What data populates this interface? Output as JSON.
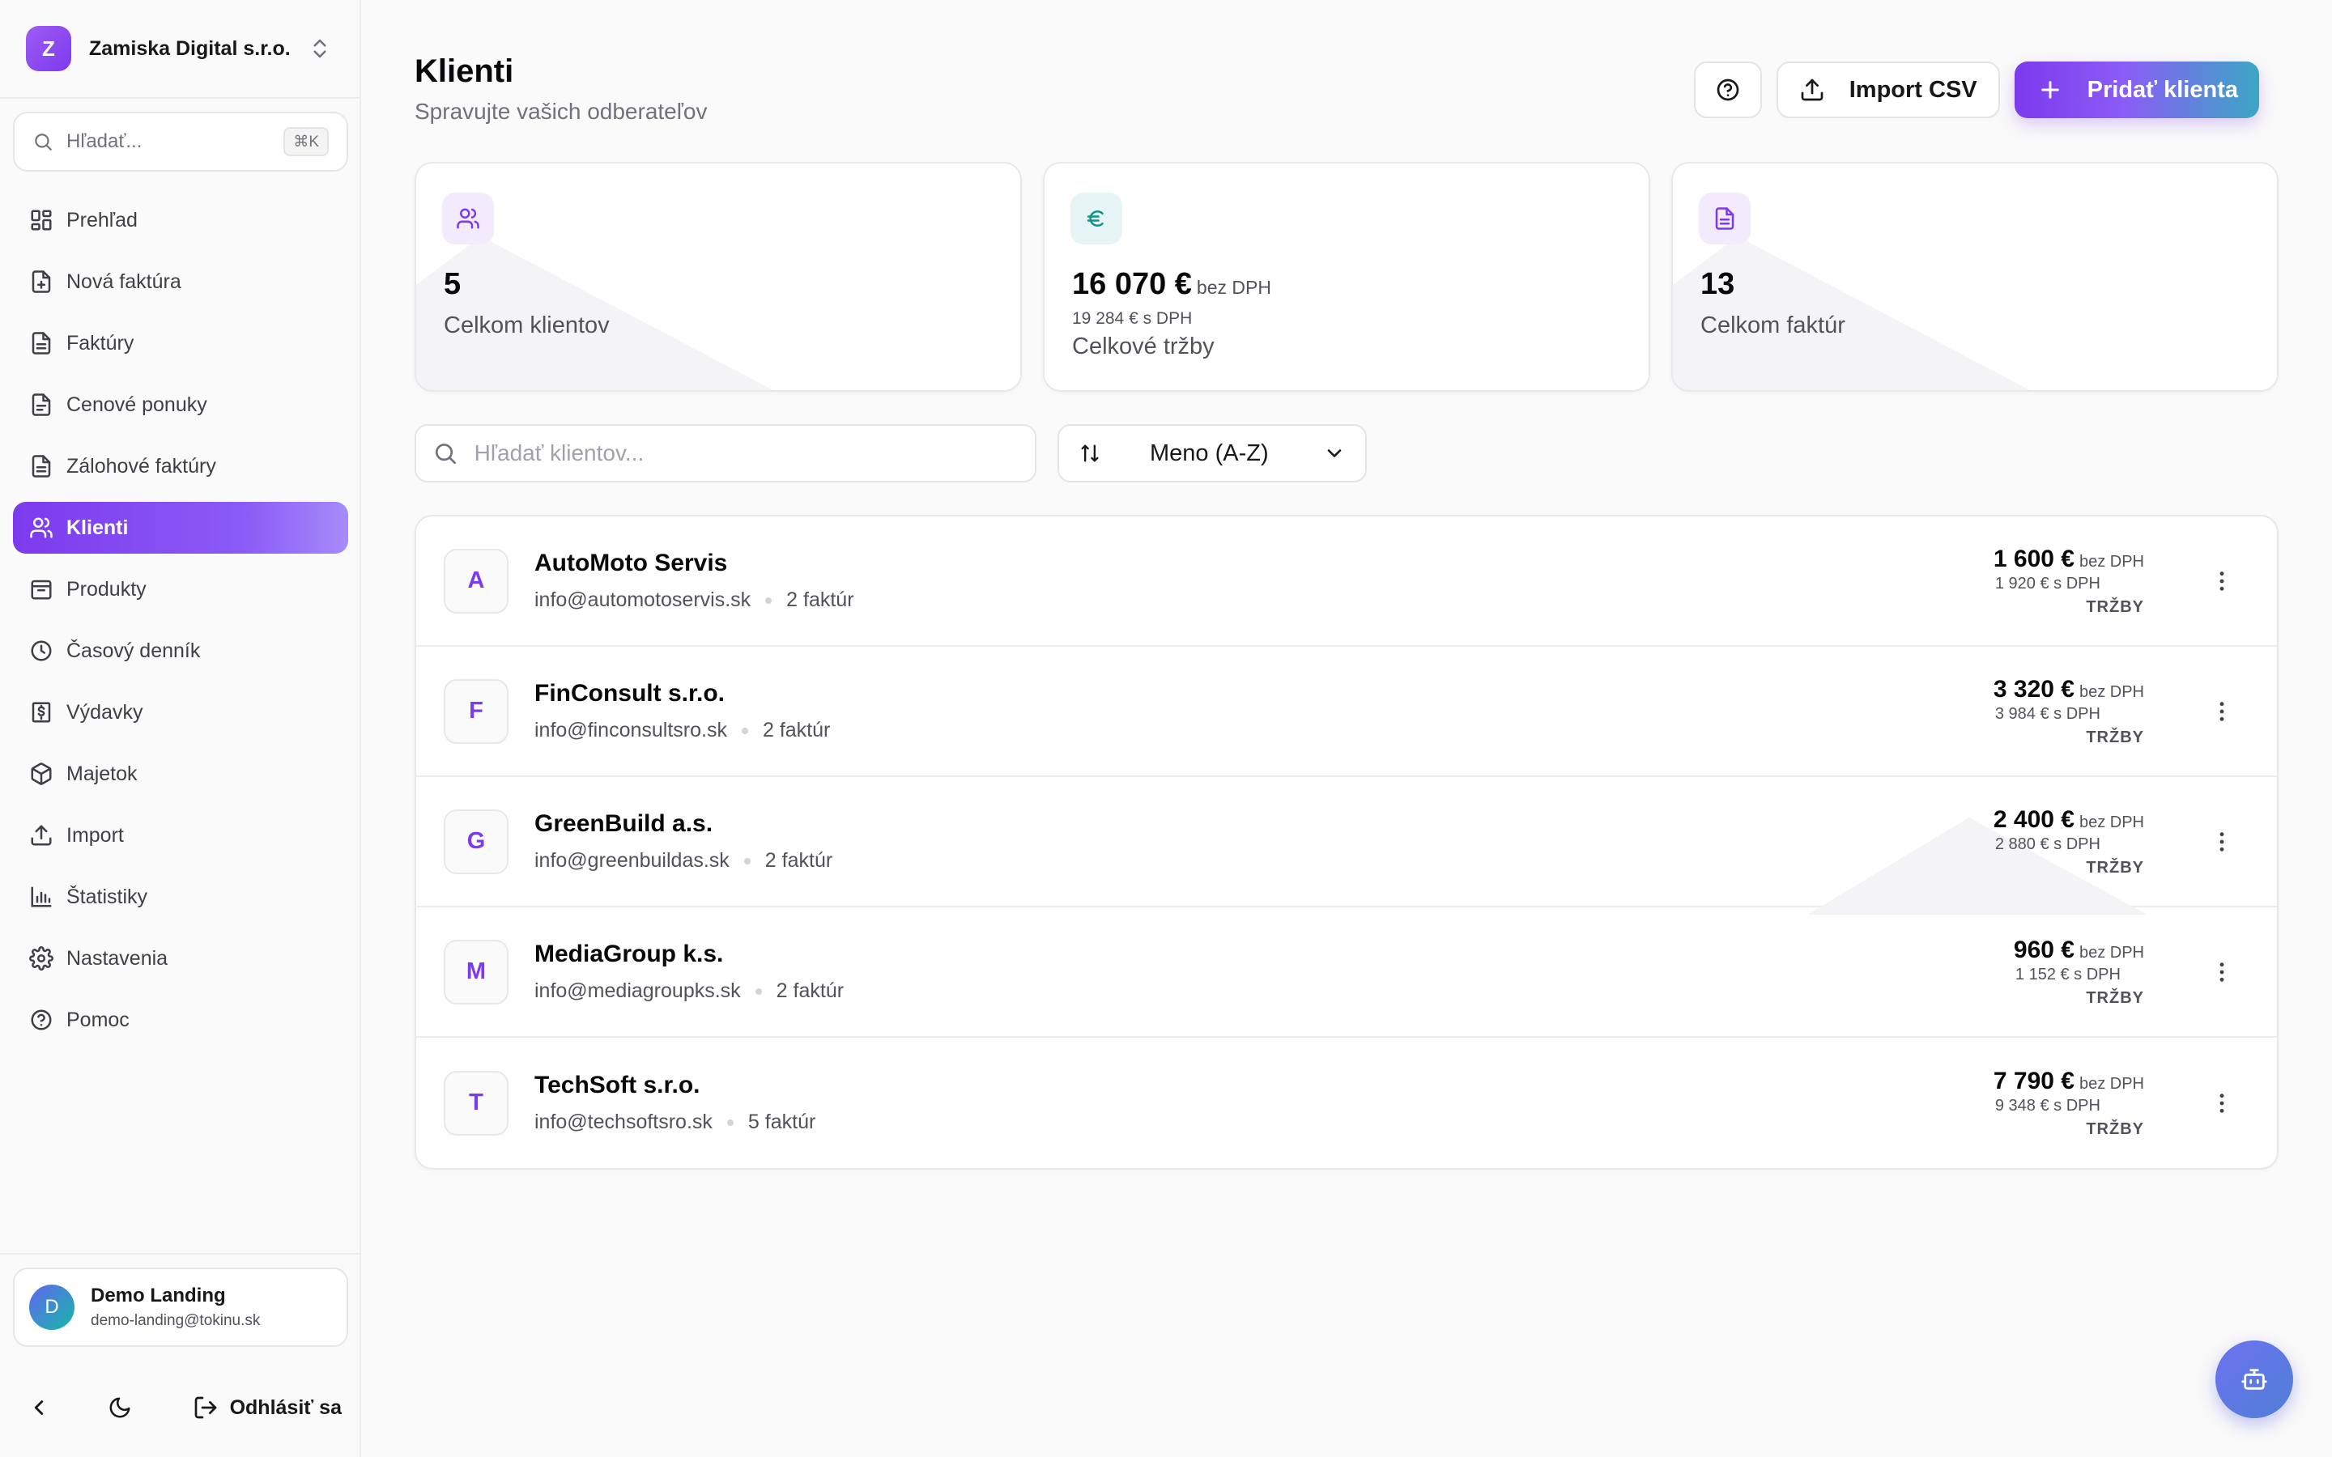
{
  "org": {
    "initial": "Z",
    "name": "Zamiska Digital s.r.o."
  },
  "sidebar": {
    "search_placeholder": "Hľadať...",
    "search_shortcut": "⌘K",
    "items": [
      {
        "label": "Prehľad",
        "icon": "dashboard-icon"
      },
      {
        "label": "Nová faktúra",
        "icon": "file-plus-icon"
      },
      {
        "label": "Faktúry",
        "icon": "file-text-icon"
      },
      {
        "label": "Cenové ponuky",
        "icon": "file-icon"
      },
      {
        "label": "Zálohové faktúry",
        "icon": "file-icon"
      },
      {
        "label": "Klienti",
        "icon": "users-icon",
        "active": true
      },
      {
        "label": "Produkty",
        "icon": "package-icon"
      },
      {
        "label": "Časový denník",
        "icon": "clock-icon"
      },
      {
        "label": "Výdavky",
        "icon": "receipt-icon"
      },
      {
        "label": "Majetok",
        "icon": "box-icon"
      },
      {
        "label": "Import",
        "icon": "upload-icon"
      },
      {
        "label": "Štatistiky",
        "icon": "bar-chart-icon"
      },
      {
        "label": "Nastavenia",
        "icon": "gear-icon"
      },
      {
        "label": "Pomoc",
        "icon": "help-icon"
      }
    ],
    "user": {
      "initial": "D",
      "name": "Demo Landing",
      "email": "demo-landing@tokinu.sk"
    },
    "logout_label": "Odhlásiť sa"
  },
  "header": {
    "title": "Klienti",
    "subtitle": "Spravujte vašich odberateľov",
    "import_label": "Import CSV",
    "add_label": "Pridať klienta"
  },
  "stats": {
    "clients": {
      "value": "5",
      "label": "Celkom klientov"
    },
    "revenue": {
      "value": "16 070 €",
      "suffix": "bez DPH",
      "sub": "19 284 € s DPH",
      "label": "Celkové tržby"
    },
    "invoices": {
      "value": "13",
      "label": "Celkom faktúr"
    }
  },
  "filters": {
    "search_placeholder": "Hľadať klientov...",
    "sort_label": "Meno (A-Z)"
  },
  "clients": [
    {
      "initial": "A",
      "name": "AutoMoto Servis",
      "email": "info@automotoservis.sk",
      "invoices": "2 faktúr",
      "net": "1 600 €",
      "net_suffix": "bez DPH",
      "gross": "1 920 € s DPH",
      "tag": "TRŽBY"
    },
    {
      "initial": "F",
      "name": "FinConsult s.r.o.",
      "email": "info@finconsultsro.sk",
      "invoices": "2 faktúr",
      "net": "3 320 €",
      "net_suffix": "bez DPH",
      "gross": "3 984 € s DPH",
      "tag": "TRŽBY"
    },
    {
      "initial": "G",
      "name": "GreenBuild a.s.",
      "email": "info@greenbuildas.sk",
      "invoices": "2 faktúr",
      "net": "2 400 €",
      "net_suffix": "bez DPH",
      "gross": "2 880 € s DPH",
      "tag": "TRŽBY"
    },
    {
      "initial": "M",
      "name": "MediaGroup k.s.",
      "email": "info@mediagroupks.sk",
      "invoices": "2 faktúr",
      "net": "960 €",
      "net_suffix": "bez DPH",
      "gross": "1 152 € s DPH",
      "tag": "TRŽBY"
    },
    {
      "initial": "T",
      "name": "TechSoft s.r.o.",
      "email": "info@techsoftsro.sk",
      "invoices": "5 faktúr",
      "net": "7 790 €",
      "net_suffix": "bez DPH",
      "gross": "9 348 € s DPH",
      "tag": "TRŽBY"
    }
  ],
  "colors": {
    "accent": "#7c3aed",
    "accent_end": "#3ba7c4",
    "teal": "#0d9488"
  }
}
